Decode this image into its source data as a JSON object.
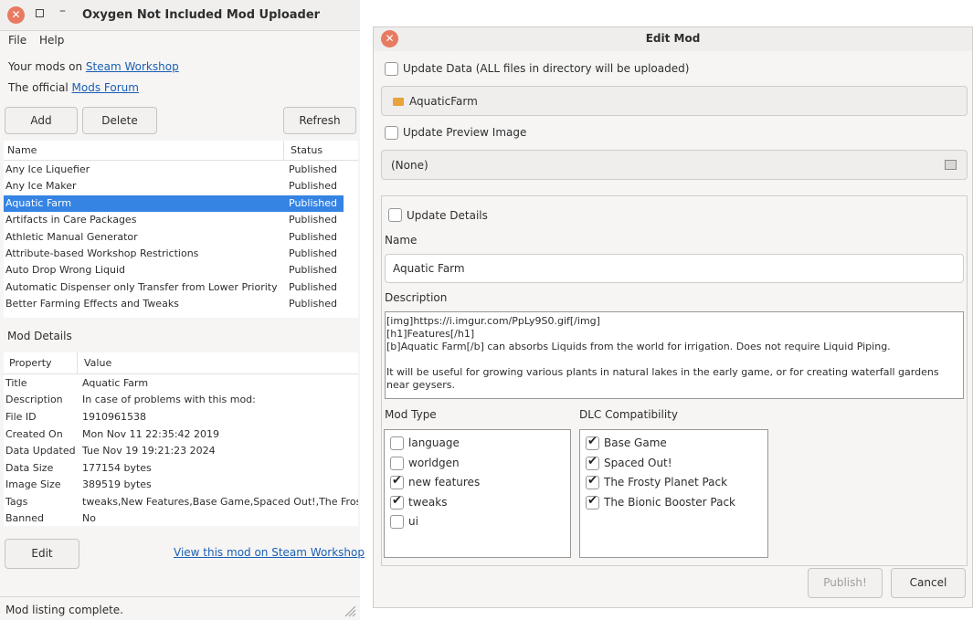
{
  "main_window": {
    "title": "Oxygen Not Included Mod Uploader",
    "menu": [
      "File",
      "Help"
    ],
    "your_mods_prefix": "Your mods on",
    "your_mods_link": "Steam Workshop",
    "official_prefix": "The official",
    "official_link": "Mods Forum",
    "buttons": {
      "add": "Add",
      "delete": "Delete",
      "refresh": "Refresh"
    },
    "mod_list": {
      "headers": {
        "name": "Name",
        "status": "Status"
      },
      "rows": [
        {
          "name": "Any Ice Liquefier",
          "status": "Published"
        },
        {
          "name": "Any Ice Maker",
          "status": "Published"
        },
        {
          "name": "Aquatic Farm",
          "status": "Published"
        },
        {
          "name": "Artifacts in Care Packages",
          "status": "Published"
        },
        {
          "name": "Athletic Manual Generator",
          "status": "Published"
        },
        {
          "name": "Attribute-based Workshop Restrictions",
          "status": "Published"
        },
        {
          "name": "Auto Drop Wrong Liquid",
          "status": "Published"
        },
        {
          "name": "Automatic Dispenser only Transfer from Lower Priority",
          "status": "Published"
        },
        {
          "name": "Better Farming Effects and Tweaks",
          "status": "Published"
        }
      ],
      "selected_index": 2
    },
    "mod_details_heading": "Mod Details",
    "details": {
      "headers": {
        "property": "Property",
        "value": "Value"
      },
      "rows": [
        {
          "key": "Title",
          "value": "Aquatic Farm"
        },
        {
          "key": "Description",
          "value": "In case of problems with this mod:"
        },
        {
          "key": "File ID",
          "value": "1910961538"
        },
        {
          "key": "Created On",
          "value": "Mon Nov 11 22:35:42 2019"
        },
        {
          "key": "Data Updated",
          "value": "Tue Nov 19 19:21:23 2024"
        },
        {
          "key": "Data Size",
          "value": "177154 bytes"
        },
        {
          "key": "Image Size",
          "value": "389519 bytes"
        },
        {
          "key": "Tags",
          "value": "tweaks,New Features,Base Game,Spaced Out!,The Frosty Planet Pack"
        },
        {
          "key": "Banned",
          "value": "No"
        }
      ]
    },
    "edit_button": "Edit",
    "view_link": "View this mod on Steam Workshop",
    "status_bar": "Mod listing complete."
  },
  "edit_dialog": {
    "title": "Edit Mod",
    "update_data_label": "Update Data (ALL files in directory will be uploaded)",
    "folder_name": "AquaticFarm",
    "update_preview_label": "Update Preview Image",
    "preview_value": "(None)",
    "update_details_label": "Update Details",
    "name_label": "Name",
    "name_value": "Aquatic Farm",
    "description_label": "Description",
    "description_lines": [
      "[img]https://i.imgur.com/PpLy9S0.gif[/img]",
      "[h1]Features[/h1]",
      "[b]Aquatic Farm[/b] can absorbs Liquids from the world for irrigation. Does not require Liquid Piping.",
      "",
      "It will be useful for growing various plants in natural lakes in the early game, or for creating waterfall gardens",
      "near geysers."
    ],
    "mod_type_label": "Mod Type",
    "mod_types": [
      {
        "label": "language",
        "checked": false
      },
      {
        "label": "worldgen",
        "checked": false
      },
      {
        "label": "new features",
        "checked": true
      },
      {
        "label": "tweaks",
        "checked": true
      },
      {
        "label": "ui",
        "checked": false
      }
    ],
    "dlc_label": "DLC Compatibility",
    "dlc": [
      {
        "label": "Base Game",
        "checked": true
      },
      {
        "label": "Spaced Out!",
        "checked": true
      },
      {
        "label": "The Frosty Planet Pack",
        "checked": true
      },
      {
        "label": "The Bionic Booster Pack",
        "checked": true
      }
    ],
    "publish_button": "Publish!",
    "cancel_button": "Cancel"
  },
  "colors": {
    "accent": "#3584e4",
    "close": "#e77a61",
    "link": "#1a5fb4"
  }
}
